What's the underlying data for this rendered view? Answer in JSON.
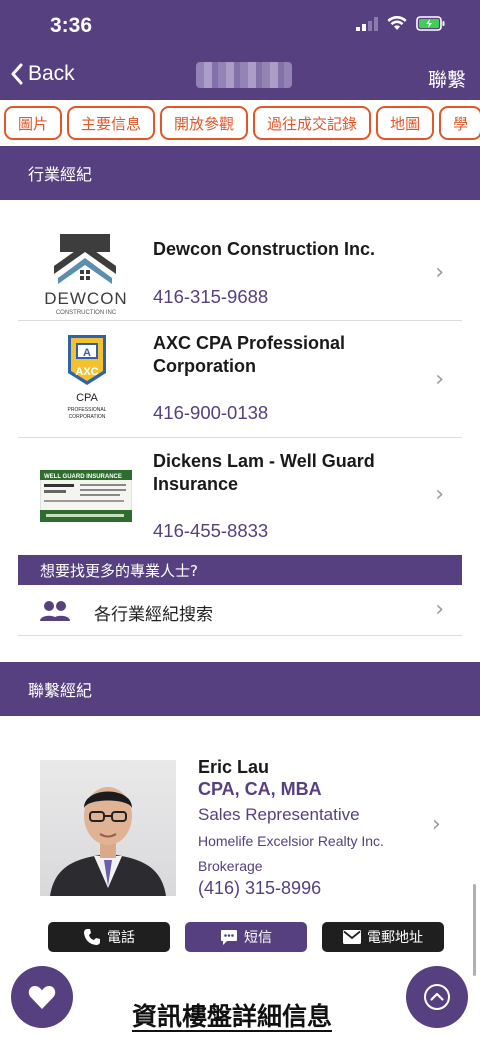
{
  "status": {
    "time": "3:36"
  },
  "nav": {
    "back_label": "Back",
    "contact_label": "聯繫"
  },
  "tabs": [
    {
      "label": "圖片"
    },
    {
      "label": "主要信息"
    },
    {
      "label": "開放參觀"
    },
    {
      "label": "過往成交記錄"
    },
    {
      "label": "地圖"
    },
    {
      "label": "學"
    }
  ],
  "industry_section": {
    "title": "行業經紀"
  },
  "professionals": [
    {
      "name": "Dewcon Construction Inc.",
      "phone": "416-315-9688",
      "logo_text": "DEWCON",
      "logo_sub": "CONSTRUCTION INC"
    },
    {
      "name": "AXC CPA Professional Corporation",
      "phone": "416-900-0138",
      "logo_text": "AXC",
      "logo_sub": "CPA",
      "logo_sub2": "PROFESSIONAL",
      "logo_sub3": "CORPORATION"
    },
    {
      "name": "Dickens Lam - Well Guard Insurance",
      "phone": "416-455-8833",
      "logo_text": "WELL GUARD INSURANCE"
    }
  ],
  "more": {
    "prompt": "想要找更多的專業人士?",
    "search_label": "各行業經紀搜索"
  },
  "contact_section": {
    "title": "聯繫經紀"
  },
  "agent": {
    "name": "Eric Lau",
    "credentials": "CPA, CA, MBA",
    "role": "Sales Representative",
    "company": "Homelife Excelsior Realty Inc.",
    "company_line2": "Brokerage",
    "phone": "(416) 315-8996"
  },
  "actions": {
    "call": "電話",
    "sms": "短信",
    "email": "電郵地址"
  },
  "bottom": {
    "title": "資訊樓盤詳細信息"
  },
  "colors": {
    "brand": "#56407f",
    "accent": "#e15728"
  }
}
